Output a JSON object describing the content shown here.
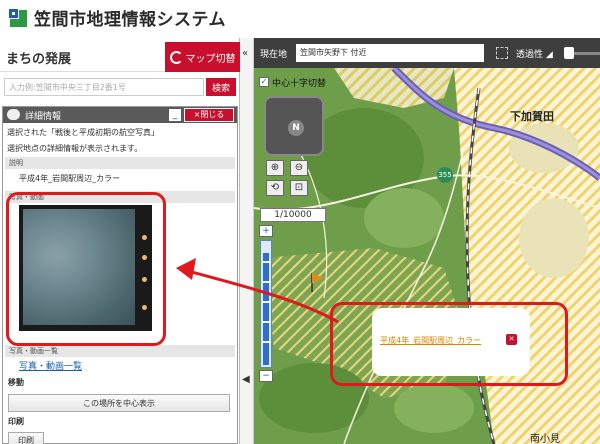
{
  "site": {
    "title": "笠間市地理情報システム"
  },
  "left_panel": {
    "title": "まちの発展",
    "map_switch_label": "マップ切替",
    "search": {
      "placeholder": "入力例:笠間市中央三丁目2番1号",
      "button": "検索"
    }
  },
  "detail": {
    "title": "詳細情報",
    "close_label": "×閉じる",
    "minimize_label": "_",
    "selected_text": "選択された「戦後と平成初期の航空写真」",
    "selected_text2": "選択地点の詳細情報が表示されます。",
    "desc_header": "説明",
    "desc_value": "平成4年_岩間駅周辺_カラー",
    "photo_header": "写真・動画",
    "photo_list_header": "写真・動画一覧",
    "photo_list_link": "写真・動画一覧"
  },
  "actions": {
    "move_header": "移動",
    "center_button": "この場所を中心表示",
    "print_header": "印刷",
    "print_button": "印刷"
  },
  "map_header": {
    "location_label": "現在地",
    "location_value": "笠間市矢野下 付近",
    "transparency_label": "透過性 ◢"
  },
  "map": {
    "crosshair_label": "中心十字切替",
    "compass_label": "N",
    "scale": "1/10000",
    "place_label_1": "下加賀田",
    "place_label_2": "南小見",
    "route_number": "355",
    "popup_link": "平成4年_岩間駅周辺_カラー",
    "zoom_plus": "+",
    "zoom_minus": "−"
  },
  "colors": {
    "accent_red": "#c8102e",
    "highlight_red": "#e0191e",
    "map_green": "#6f9e4a"
  }
}
